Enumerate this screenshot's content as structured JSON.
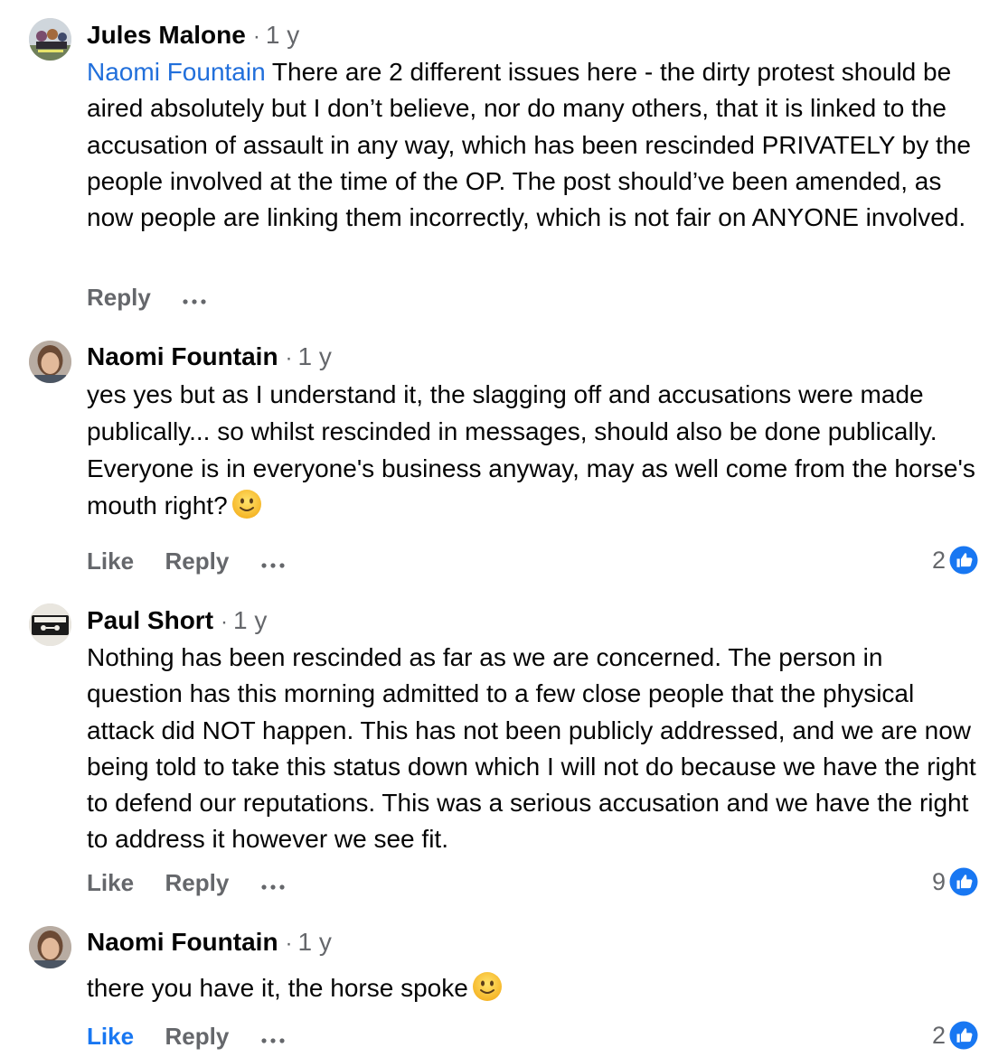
{
  "comments": [
    {
      "author": "Jules Malone",
      "separator": "·",
      "time": "1 y",
      "mention": "Naomi Fountain",
      "text": " There are 2 different issues here - the dirty protest should be aired absolutely but I don’t believe, nor do many others, that it is linked to the accusation of assault in any way, which has been rescinded PRIVATELY by the people involved at the time of the OP. The post should’ve been amended, as now people are linking them incorrectly, which is not fair on ANYONE involved.",
      "actions": {
        "reply": "Reply"
      }
    },
    {
      "author": "Naomi Fountain",
      "separator": "·",
      "time": "1 y",
      "text": "yes yes but as I understand it, the slagging off and accusations were made publically... so whilst rescinded in messages, should also be done publically.  Everyone is in everyone's business anyway, may as well come from the horse's mouth right?",
      "emoji": "slightly-smiling-face-icon",
      "actions": {
        "like": "Like",
        "reply": "Reply"
      },
      "reaction_count": "2"
    },
    {
      "author": "Paul Short",
      "separator": "·",
      "time": "1 y",
      "text": "Nothing has been rescinded as far as we are concerned. The person in question has this morning admitted to a few close people that the physical attack did NOT happen. This has not been publicly addressed, and we are now  being told to take this status down which I will not do because we have the right to defend our reputations. This was a serious accusation and we have the right to address it however we see fit.",
      "actions": {
        "like": "Like",
        "reply": "Reply"
      },
      "reaction_count": "9"
    },
    {
      "author": "Naomi Fountain",
      "separator": "·",
      "time": "1 y",
      "text": "there you have it, the horse spoke",
      "emoji": "slightly-smiling-face-icon",
      "actions": {
        "like": "Like",
        "reply": "Reply"
      },
      "reaction_count": "2",
      "liked": true
    }
  ],
  "colors": {
    "text": "#050505",
    "secondary": "#65676b",
    "mention": "#216fdb",
    "like_active": "#1877f2",
    "reaction_badge": "#1877f2"
  },
  "icons": {
    "more": "more-dots-icon",
    "reaction": "thumbs-up-reaction-icon"
  }
}
